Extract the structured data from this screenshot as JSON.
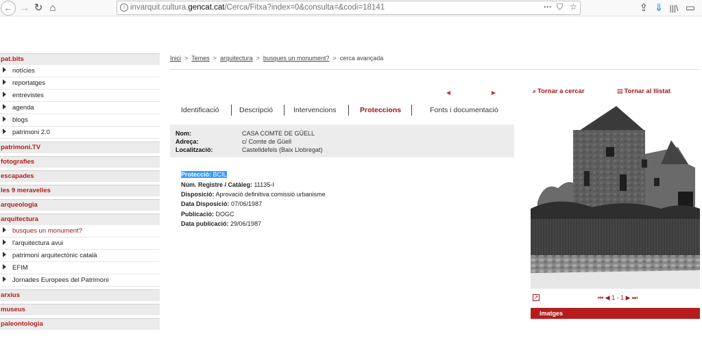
{
  "browser": {
    "url_prefix": "invarquit.cultura.",
    "url_domain": "gencat.cat",
    "url_path": "/Cerca/Fitxa?index=0&consulta=&codi=18141"
  },
  "sidebar": {
    "groups": [
      {
        "label": "pat.bits",
        "items": [
          "notícies",
          "reportatges",
          "entrevistes",
          "agenda",
          "blogs",
          "patrimoni 2.0"
        ]
      },
      {
        "label": "patrimoni.TV",
        "items": []
      },
      {
        "label": "fotografies",
        "items": []
      },
      {
        "label": "escapades",
        "items": []
      },
      {
        "label": "les 9 meravelles",
        "items": []
      },
      {
        "label": "arqueologia",
        "items": []
      },
      {
        "label": "arquitectura",
        "items": [
          "busques un monument?",
          "l'arquitectura avui",
          "patrimoni arquitectònic català",
          "EFIM",
          "Jornades Europees del Patrimoni"
        ]
      },
      {
        "label": "arxius",
        "items": []
      },
      {
        "label": "museus",
        "items": []
      },
      {
        "label": "paleontologia",
        "items": []
      }
    ]
  },
  "breadcrumb": {
    "inici": "Inici",
    "temes": "Temes",
    "arquitectura": "arquitectura",
    "busques": "busques un monument?",
    "current": "cerca avançada"
  },
  "tabs": {
    "identificacio": "Identificació",
    "descripcio": "Descripció",
    "intervencions": "Intervencions",
    "proteccions": "Proteccions",
    "fonts": "Fonts i documentació"
  },
  "info": {
    "nom_label": "Nom:",
    "nom_value": "CASA COMTE DE GÜELL",
    "adreca_label": "Adreça:",
    "adreca_value": "c/ Comte de Güell",
    "localitzacio_label": "Localització:",
    "localitzacio_value": "Castelldefels (Baix Llobregat)"
  },
  "proteccio": {
    "proteccio_label": "Protecció:",
    "proteccio_value": "BCIL",
    "registre_label": "Núm. Registre / Catàleg:",
    "registre_value": "11135-I",
    "disposicio_label": "Disposició:",
    "disposicio_value": "Aprovació definitiva comissió urbanisme",
    "data_disposicio_label": "Data Disposició:",
    "data_disposicio_value": "07/06/1987",
    "publicacio_label": "Publicació:",
    "publicacio_value": "DOGC",
    "data_publicacio_label": "Data publicació:",
    "data_publicacio_value": "29/06/1987"
  },
  "right": {
    "tornar_cercar": "Tornar a cercar",
    "tornar_llistat": "Tornar al llistat",
    "pager_text": "1 - 1",
    "imatges": "Imatges"
  }
}
